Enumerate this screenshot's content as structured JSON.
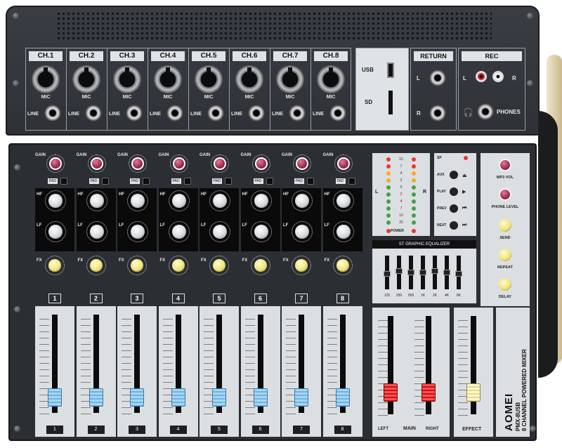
{
  "rear_panel": {
    "channels": [
      "CH.1",
      "CH.2",
      "CH.3",
      "CH.4",
      "CH.5",
      "CH.6",
      "CH.7",
      "CH.8"
    ],
    "mic_label": "MIC",
    "line_label": "LINE",
    "usb_label": "USB",
    "sd_label": "SD",
    "return_title": "RETURN",
    "return_l": "L",
    "return_r": "R",
    "rec_title": "REC",
    "rec_l": "L",
    "rec_r": "R",
    "phones_label": "PHONES"
  },
  "channel_strip": {
    "gain_label": "GAIN",
    "pad_label": "PAD",
    "hf_label": "HF",
    "lf_label": "LF",
    "fx_label": "FX",
    "numbers": [
      "1",
      "2",
      "3",
      "4",
      "5",
      "6",
      "7",
      "8"
    ]
  },
  "meter": {
    "left": "L",
    "right": "R",
    "sp_label": "SP",
    "power_label": "POWER",
    "values": [
      "10",
      "7",
      "4",
      "2",
      "0",
      "2",
      "4",
      "7",
      "10",
      "20"
    ]
  },
  "player": {
    "aux": "AUX",
    "play": "PLAY",
    "prev": "PREV",
    "next": "NEXT"
  },
  "graphic_eq": {
    "title": "ST GRAPHIC EQUALIZER",
    "bands": [
      "125",
      "250",
      "500",
      "1K",
      "2K",
      "4K",
      "8K"
    ],
    "levels": [
      0.55,
      0.45,
      0.5,
      0.5,
      0.45,
      0.5,
      0.55
    ]
  },
  "master_controls": {
    "mp3_vol": "MP3 VOL",
    "phone_level": "PHONE LEVEL",
    "send": "SEND",
    "repeat": "REPEAT",
    "delay": "DELAY"
  },
  "faders": {
    "channel_positions": [
      0.82,
      0.82,
      0.82,
      0.82,
      0.82,
      0.82,
      0.82,
      0.82
    ],
    "main_left_label": "LEFT",
    "main_label": "MAIN",
    "main_right_label": "RIGHT",
    "effect_label": "EFFECT",
    "main_positions": [
      0.75,
      0.75
    ],
    "effect_position": 0.75
  },
  "branding": {
    "brand": "AOMEI",
    "model": "PMX-8USB",
    "subtitle": "8 CHANNEL POWERED MIXER"
  }
}
